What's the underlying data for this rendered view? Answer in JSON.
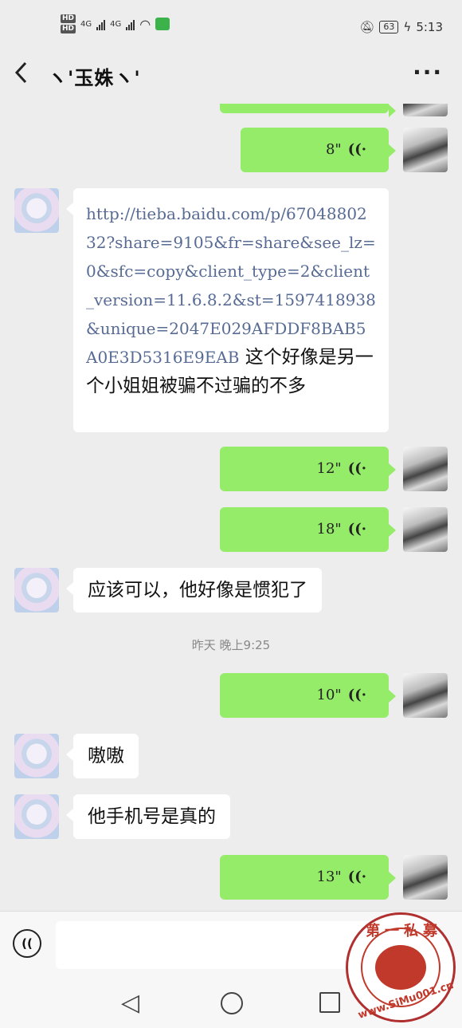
{
  "status_bar": {
    "hd1": "HD",
    "hd2": "HD",
    "net1": "4G",
    "net2": "4G",
    "app_icon": "iqiyi-icon",
    "mute_icon": "bell-off-icon",
    "battery": "63",
    "time": "5:13"
  },
  "header": {
    "back_icon": "chevron-left-icon",
    "title": "ヽ'玉姝ヽ'",
    "more_icon": "ellipsis-icon"
  },
  "messages": [
    {
      "side": "right",
      "type": "voice",
      "duration": "8\""
    },
    {
      "side": "left",
      "type": "text",
      "link_text": "http://tieba.baidu.com/p/6704880232?share=9105&fr=share&see_lz=0&sfc=copy&client_type=2&client_version=11.6.8.2&st=1597418938&unique=2047E029AFDDF8BAB5A0E3D5316E9EAB",
      "text": " 这个好像是另一个小姐姐被骗不过骗的不多"
    },
    {
      "side": "right",
      "type": "voice",
      "duration": "12\""
    },
    {
      "side": "right",
      "type": "voice",
      "duration": "18\""
    },
    {
      "side": "left",
      "type": "text",
      "text": "应该可以，他好像是惯犯了"
    },
    {
      "type": "timestamp",
      "text": "昨天 晚上9:25"
    },
    {
      "side": "right",
      "type": "voice",
      "duration": "10\""
    },
    {
      "side": "left",
      "type": "text",
      "text": "嗷嗷"
    },
    {
      "side": "left",
      "type": "text",
      "text": "他手机号是真的"
    },
    {
      "side": "right",
      "type": "voice",
      "duration": "13\""
    }
  ],
  "input_bar": {
    "voice_icon": "voice-input-icon",
    "placeholder": ""
  },
  "nav_bar": {
    "back": "triangle-back-icon",
    "home": "circle-home-icon",
    "recent": "square-recent-icon"
  },
  "watermark": {
    "top_text": "第一私募",
    "bottom_text": "www.SiMu001.cn"
  }
}
